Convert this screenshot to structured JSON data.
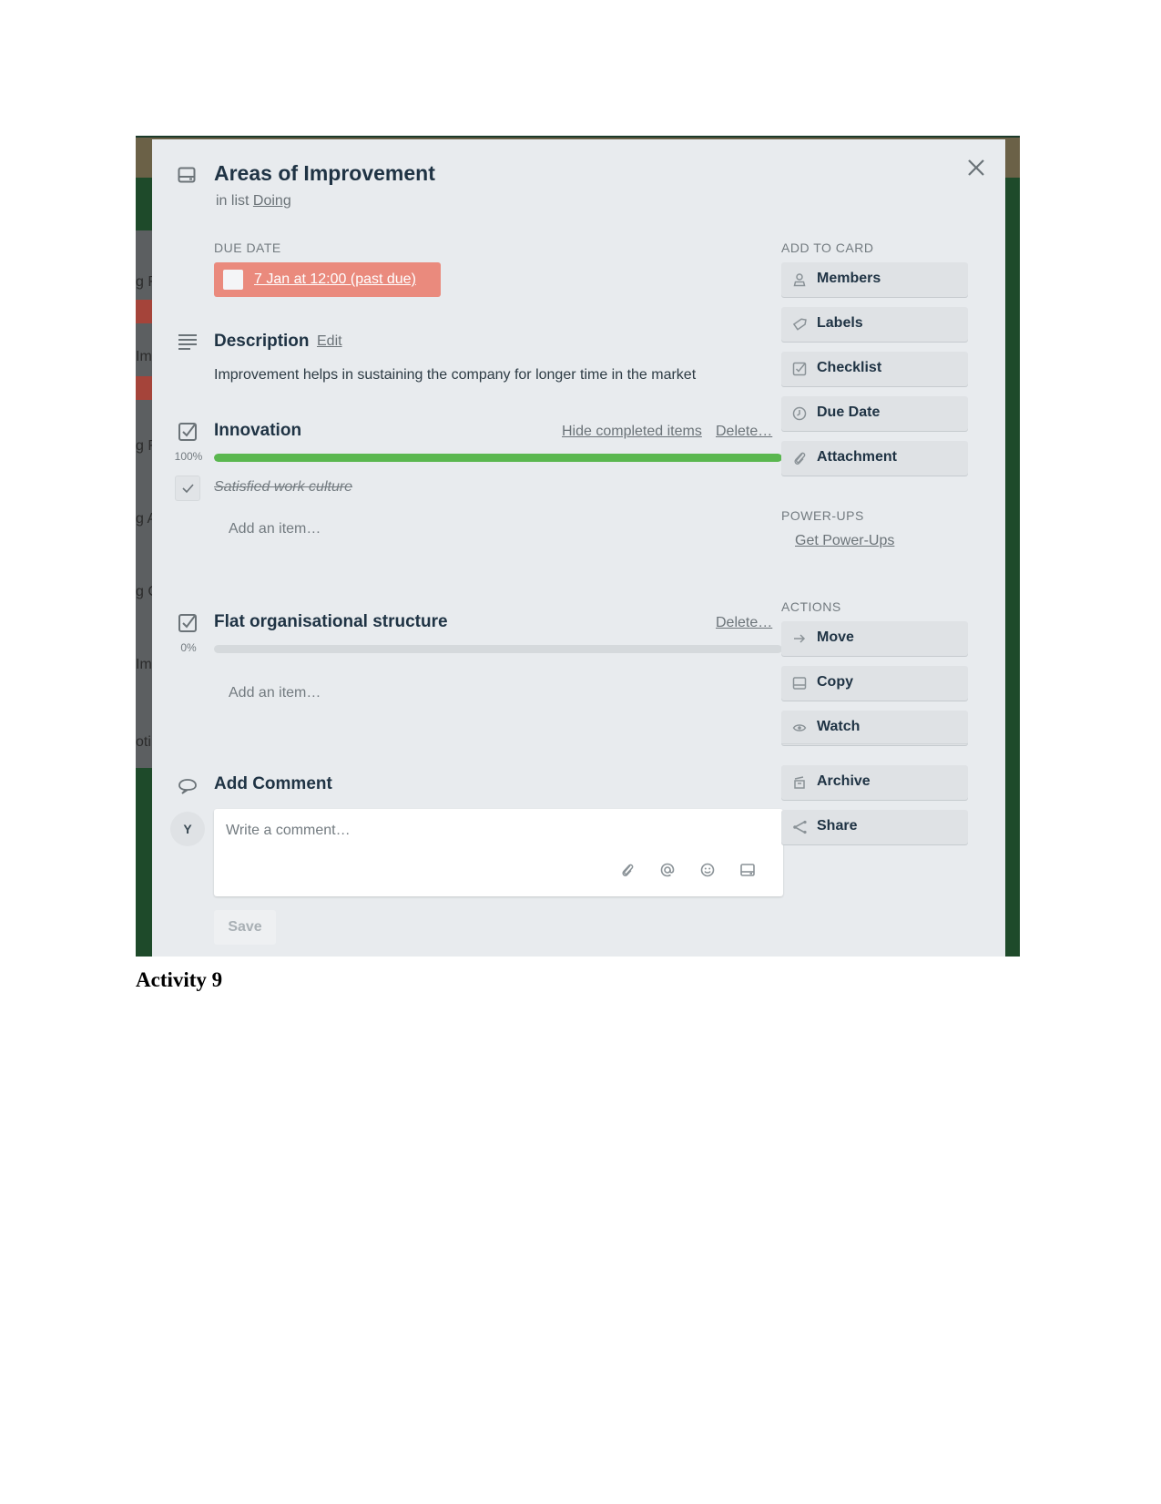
{
  "card": {
    "title": "Areas of Improvement",
    "list_prefix": "in list",
    "list_name": "Doing"
  },
  "due_date": {
    "label": "DUE DATE",
    "value": "7 Jan at 12:00 (past due)",
    "color": "#ea8a7d"
  },
  "description": {
    "heading": "Description",
    "edit_label": "Edit",
    "text": "Improvement helps in sustaining the company for longer time in the market"
  },
  "checklists": [
    {
      "title": "Innovation",
      "hide_label": "Hide completed items",
      "delete_label": "Delete…",
      "progress_label": "100%",
      "progress": 1.0,
      "items": [
        {
          "text": "Satisfied work culture",
          "checked": true
        }
      ],
      "add_item_placeholder": "Add an item…"
    },
    {
      "title": "Flat organisational structure",
      "delete_label": "Delete…",
      "progress_label": "0%",
      "progress": 0.0,
      "items": [],
      "add_item_placeholder": "Add an item…"
    }
  ],
  "comment": {
    "heading": "Add Comment",
    "avatar_initial": "Y",
    "placeholder": "Write a comment…",
    "icons": [
      "attachment-icon",
      "mention-icon",
      "emoji-icon",
      "card-icon"
    ],
    "save_label": "Save"
  },
  "sidebar": {
    "add_to_card_label": "ADD TO CARD",
    "add_to_card": [
      {
        "label": "Members",
        "icon": "person-icon"
      },
      {
        "label": "Labels",
        "icon": "tag-icon"
      },
      {
        "label": "Checklist",
        "icon": "checklist-icon"
      },
      {
        "label": "Due Date",
        "icon": "clock-icon"
      },
      {
        "label": "Attachment",
        "icon": "paperclip-icon"
      }
    ],
    "powerups_label": "POWER-UPS",
    "powerups_link": "Get Power-Ups",
    "actions_label": "ACTIONS",
    "actions": [
      {
        "label": "Move",
        "icon": "arrow-right-icon"
      },
      {
        "label": "Copy",
        "icon": "card-icon"
      },
      {
        "label": "Watch",
        "icon": "eye-icon"
      },
      {
        "label": "Archive",
        "icon": "archive-icon"
      },
      {
        "label": "Share",
        "icon": "share-icon"
      }
    ]
  },
  "background_board": {
    "card_fragments": [
      "g R",
      "Im",
      "g R",
      "g A",
      "g C",
      "Im",
      "oti"
    ]
  },
  "caption": "Activity 9",
  "colors": {
    "progress_complete": "#5ab74f",
    "modal_bg": "#e8ebee",
    "board_bg": "#1e4a2a"
  }
}
